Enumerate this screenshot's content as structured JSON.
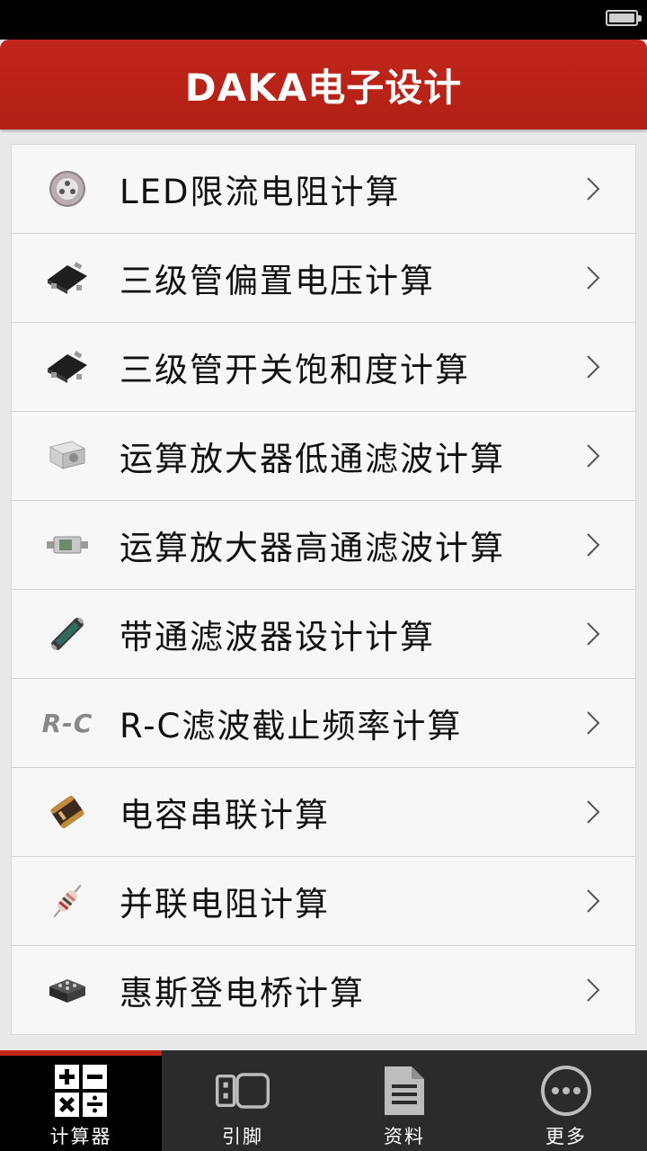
{
  "header": {
    "title": "DAKA电子设计"
  },
  "menu": [
    {
      "label": "LED限流电阻计算",
      "icon": "led-icon"
    },
    {
      "label": "三级管偏置电压计算",
      "icon": "transistor-icon"
    },
    {
      "label": "三级管开关饱和度计算",
      "icon": "transistor-icon"
    },
    {
      "label": "运算放大器低通滤波计算",
      "icon": "connector-icon"
    },
    {
      "label": "运算放大器高通滤波计算",
      "icon": "filter-component-icon"
    },
    {
      "label": "带通滤波器设计计算",
      "icon": "bandpass-component-icon"
    },
    {
      "label": "R-C滤波截止频率计算",
      "icon": "rc-text-icon",
      "icon_text": "R-C"
    },
    {
      "label": "电容串联计算",
      "icon": "capacitor-icon"
    },
    {
      "label": "并联电阻计算",
      "icon": "resistor-icon"
    },
    {
      "label": "惠斯登电桥计算",
      "icon": "bridge-chip-icon"
    }
  ],
  "tabs": [
    {
      "label": "计算器",
      "icon": "calculator-icon",
      "active": true
    },
    {
      "label": "引脚",
      "icon": "pinout-icon",
      "active": false
    },
    {
      "label": "资料",
      "icon": "document-icon",
      "active": false
    },
    {
      "label": "更多",
      "icon": "more-icon",
      "active": false
    }
  ],
  "colors": {
    "header": "#b21f14",
    "tabbar": "#2b2b2b",
    "active_tab_indicator": "#c1271b"
  }
}
